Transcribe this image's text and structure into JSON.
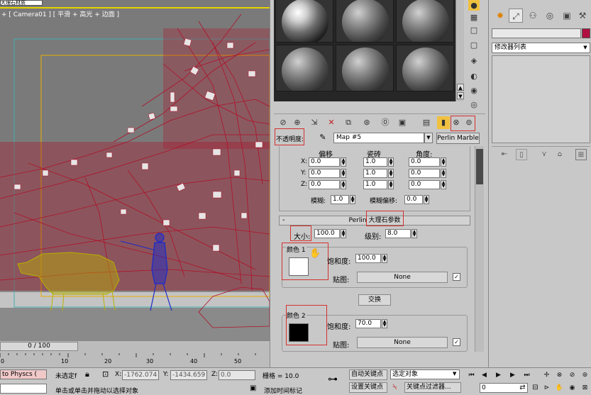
{
  "viewport": {
    "window_title": "大理石材质",
    "label": "+ [ Camera01 ] [ 平滑 + 高光 + 边面 ]",
    "colors": {
      "background": "#7a7a7a",
      "tree": "#b01028",
      "ox": "#b8b000",
      "person": "#1c2ac8",
      "safe_frame": "#e6b000",
      "region": "#40b0b0"
    }
  },
  "timeline": {
    "slider": "0 / 100",
    "ticks": [
      "0",
      "10",
      "20",
      "30",
      "40",
      "50"
    ]
  },
  "material_editor": {
    "map_label": "不透明度:",
    "map_name": "Map #5",
    "map_type": "Perlin Marble",
    "coords": {
      "headers": {
        "offset": "偏移",
        "tiling": "瓷砖",
        "angle": "角度:"
      },
      "rows": [
        {
          "axis": "X:",
          "offset": "0.0",
          "tiling": "1.0",
          "angle": "0.0"
        },
        {
          "axis": "Y:",
          "offset": "0.0",
          "tiling": "1.0",
          "angle": "0.0"
        },
        {
          "axis": "Z:",
          "offset": "0.0",
          "tiling": "1.0",
          "angle": "0.0"
        }
      ],
      "blur_label": "模糊:",
      "blur": "1.0",
      "blur_offset_label": "模糊偏移:",
      "blur_offset": "0.0"
    },
    "perlin": {
      "minus": "-",
      "header": "Perlin 大理石参数",
      "size_label": "大小:",
      "size": "100.0",
      "levels_label": "级别:",
      "levels": "8.0",
      "color1": {
        "label": "颜色 1",
        "swatch": "#ffffff",
        "saturation_label": "饱和度:",
        "saturation": "100.0",
        "map_label": "贴图:",
        "map": "None",
        "checked": "✓"
      },
      "color2": {
        "label": "颜色 2",
        "swatch": "#000000",
        "saturation_label": "饱和度:",
        "saturation": "70.0",
        "map_label": "贴图:",
        "map": "None",
        "checked": "✓"
      },
      "swap": "交换"
    }
  },
  "command_panel": {
    "modifier_list": "修改器列表",
    "object_color": "#b01040"
  },
  "statusbar": {
    "script": "to Physcs (",
    "selection": "未选定f",
    "x_label": "X:",
    "x": "-1762.074",
    "y_label": "Y:",
    "y": "-1434.659",
    "z_label": "Z:",
    "z": "0.0",
    "grid": "栅格 = 10.0",
    "auto_key": "自动关键点",
    "set_key": "设置关键点",
    "selected_object": "选定对象",
    "key_filters": "关键点过滤器...",
    "frame": "0",
    "prompt": "单击或单击并拖动以选择对象",
    "add_time_tag": "添加时间标记"
  }
}
